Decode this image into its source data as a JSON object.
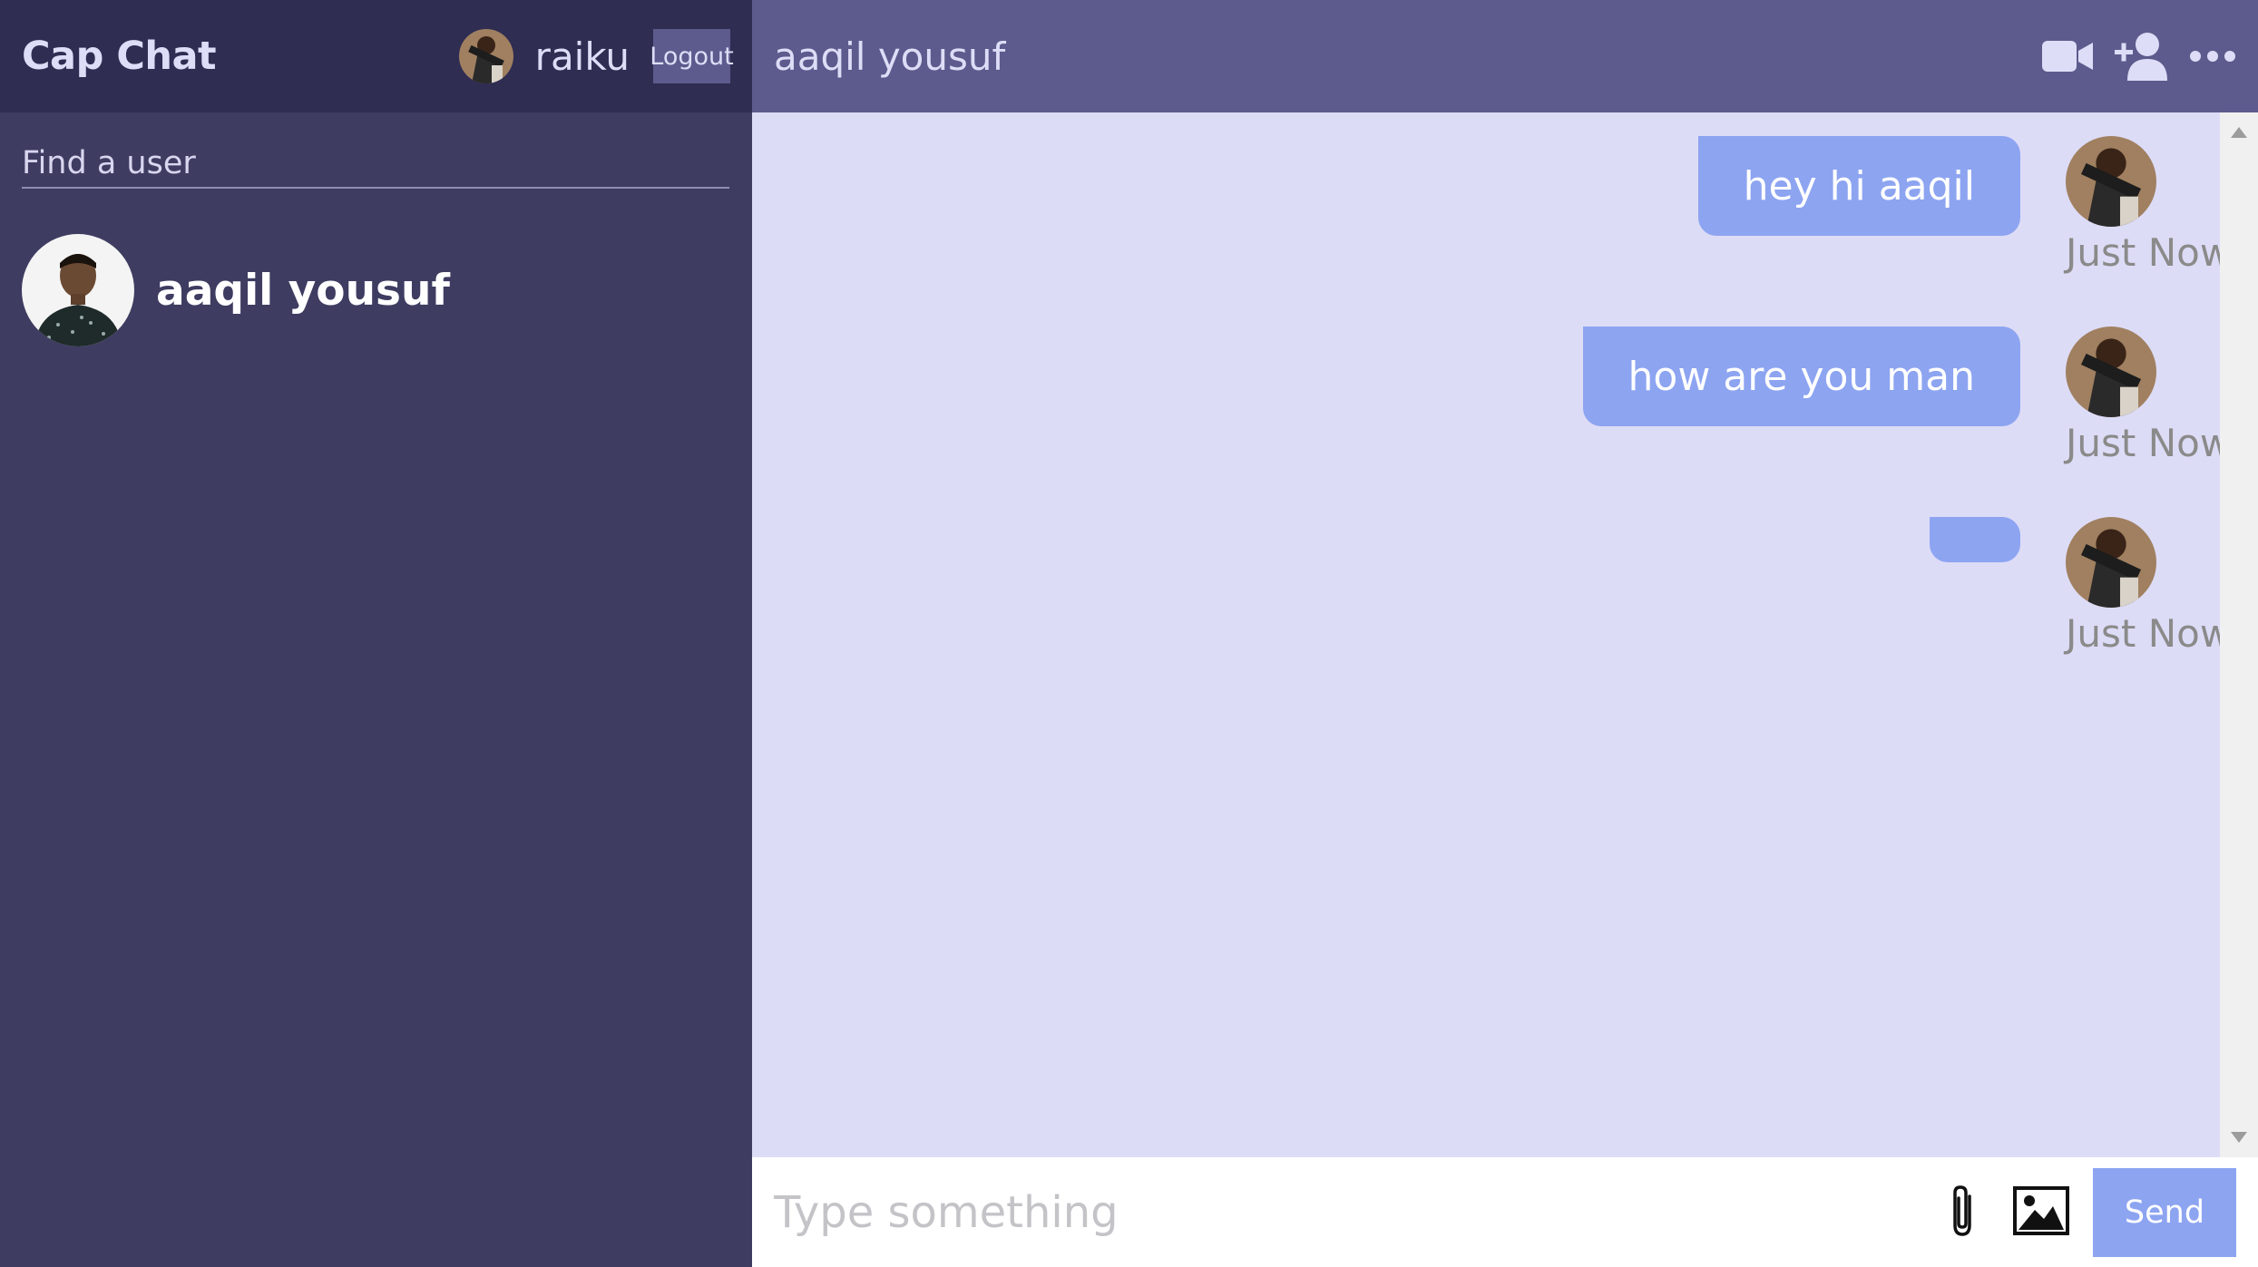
{
  "sidebar": {
    "brand": "Cap Chat",
    "current_user": "raiku",
    "logout_label": "Logout",
    "search_placeholder": "Find a user",
    "users": [
      {
        "name": "aaqil yousuf"
      }
    ]
  },
  "chat": {
    "title": "aaqil yousuf",
    "icons": [
      "video-camera-icon",
      "add-user-icon",
      "more-options-icon"
    ],
    "messages": [
      {
        "text": "hey hi aaqil",
        "time": "Just Now"
      },
      {
        "text": "how are you man",
        "time": "Just Now"
      },
      {
        "text": "",
        "time": "Just Now"
      }
    ],
    "input_placeholder": "Type something",
    "send_label": "Send"
  },
  "colors": {
    "sidebar_bg": "#3e3c61",
    "sidebar_header_bg": "#2f2d52",
    "chat_header_bg": "#5d5b8d",
    "chat_bg": "#dddcf7",
    "bubble": "#8da4f1"
  }
}
